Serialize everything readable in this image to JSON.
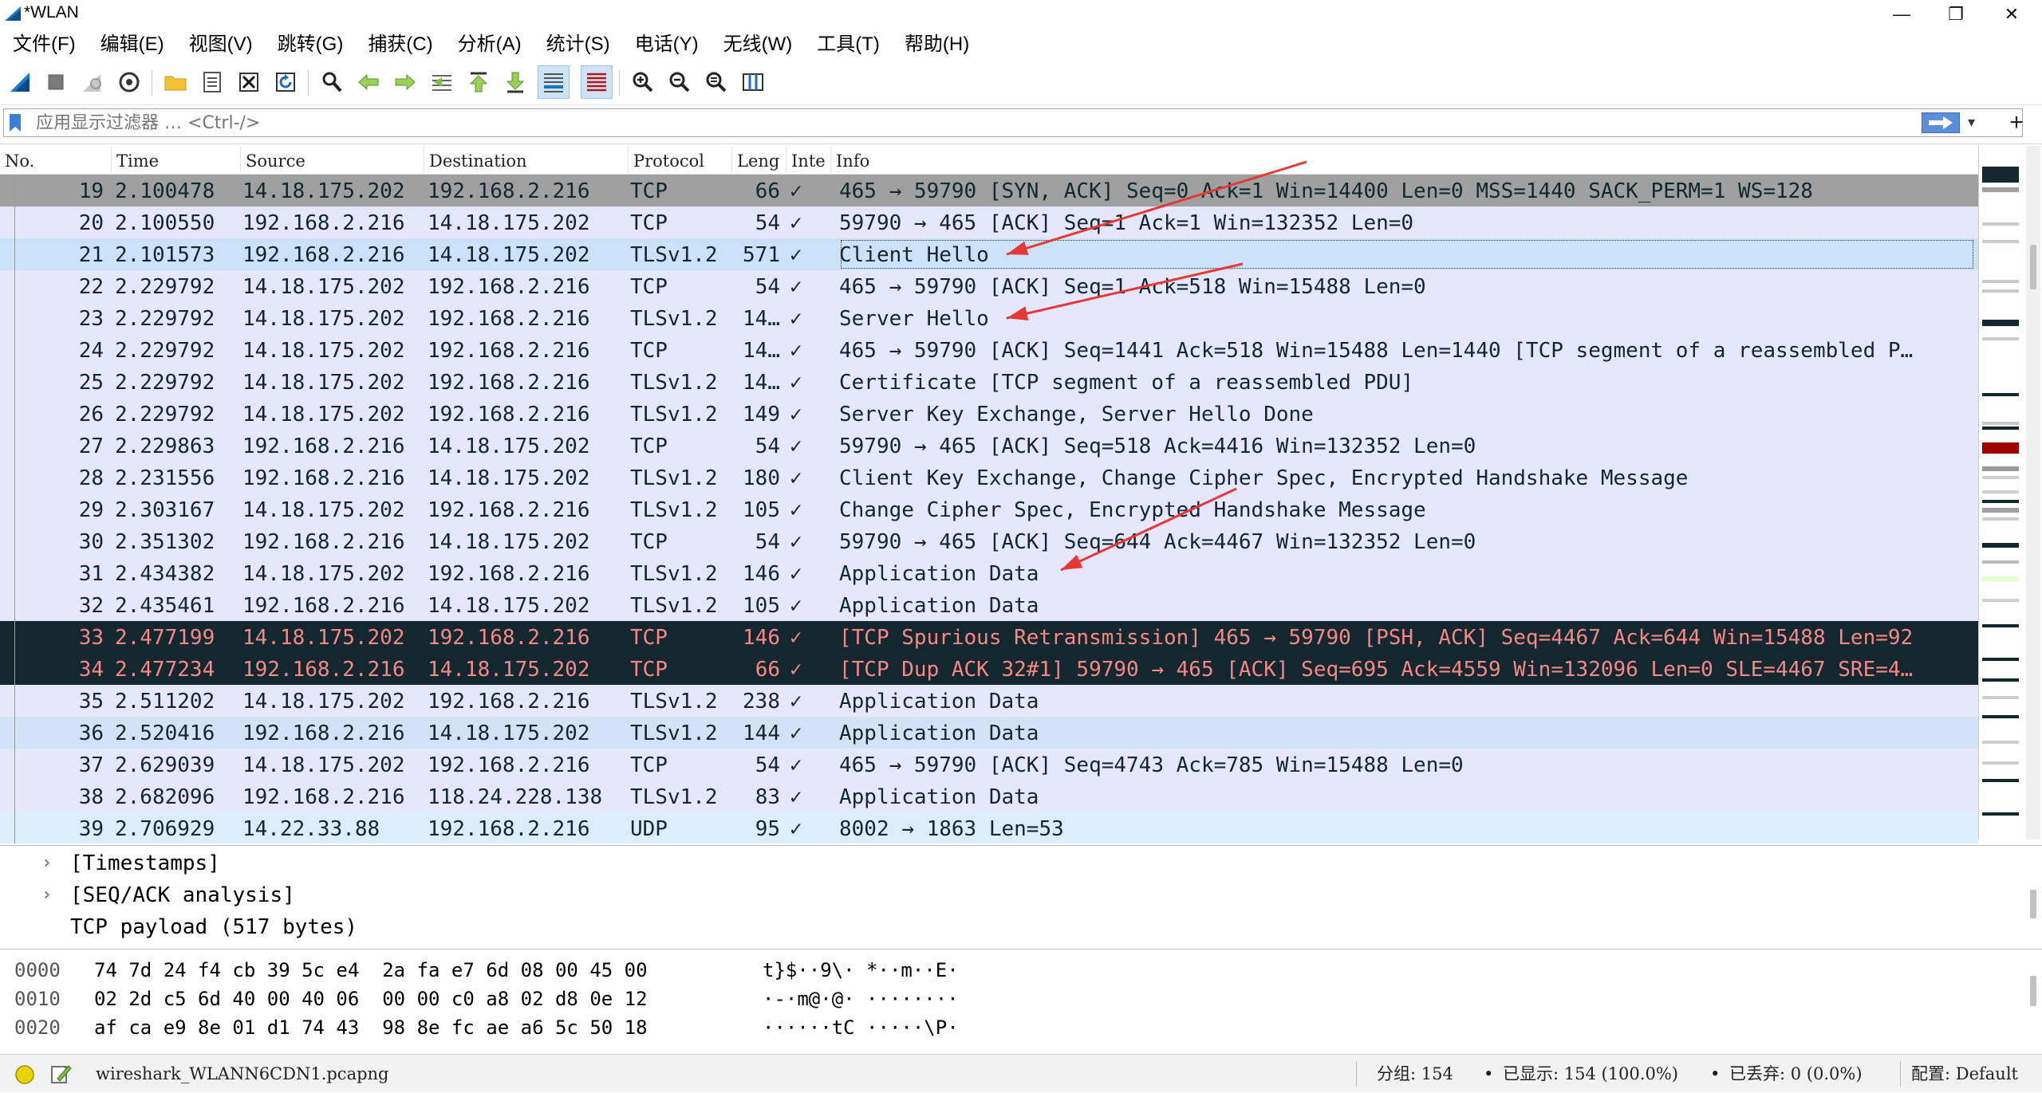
{
  "window": {
    "title": "*WLAN",
    "min_glyph": "—",
    "max_glyph": "❐",
    "close_glyph": "✕"
  },
  "menu": [
    "文件(F)",
    "编辑(E)",
    "视图(V)",
    "跳转(G)",
    "捕获(C)",
    "分析(A)",
    "统计(S)",
    "电话(Y)",
    "无线(W)",
    "工具(T)",
    "帮助(H)"
  ],
  "toolbar": {
    "icons": [
      "shark-fin-start-icon",
      "stop-capture-icon",
      "restart-capture-icon",
      "capture-options-icon",
      "open-folder-icon",
      "save-file-icon",
      "close-file-icon",
      "reload-icon",
      "find-icon",
      "go-back-icon",
      "go-forward-icon",
      "go-to-packet-icon",
      "go-first-icon",
      "go-last-icon",
      "autoscroll-icon",
      "colorize-icon",
      "zoom-in-icon",
      "zoom-out-icon",
      "zoom-normal-icon",
      "resize-columns-icon"
    ],
    "pressed": [
      "autoscroll-icon",
      "colorize-icon"
    ]
  },
  "filter": {
    "placeholder": "应用显示过滤器 … <Ctrl-/>",
    "value": "",
    "add_glyph": "+",
    "dropdown_glyph": "▾"
  },
  "columns": [
    "No.",
    "Time",
    "Source",
    "Destination",
    "Protocol",
    "Leng",
    "Inte",
    "Info"
  ],
  "packets": [
    {
      "no": "19",
      "time": "2.100478",
      "src": "14.18.175.202",
      "dst": "192.168.2.216",
      "proto": "TCP",
      "len": "66",
      "inte": "✓",
      "info": "465 → 59790 [SYN, ACK] Seq=0 Ack=1 Win=14400 Len=0 MSS=1440 SACK_PERM=1 WS=128",
      "bg": "#a0a0a0",
      "fg": "#12272e"
    },
    {
      "no": "20",
      "time": "2.100550",
      "src": "192.168.2.216",
      "dst": "14.18.175.202",
      "proto": "TCP",
      "len": "54",
      "inte": "✓",
      "info": "59790 → 465 [ACK] Seq=1 Ack=1 Win=132352 Len=0",
      "bg": "#e7e6ff",
      "fg": "#12272e"
    },
    {
      "no": "21",
      "time": "2.101573",
      "src": "192.168.2.216",
      "dst": "14.18.175.202",
      "proto": "TLSv1.2",
      "len": "571",
      "inte": "✓",
      "info": "Client Hello",
      "bg": "#cce2fa",
      "fg": "#12272e",
      "selected": true
    },
    {
      "no": "22",
      "time": "2.229792",
      "src": "14.18.175.202",
      "dst": "192.168.2.216",
      "proto": "TCP",
      "len": "54",
      "inte": "✓",
      "info": "465 → 59790 [ACK] Seq=1 Ack=518 Win=15488 Len=0",
      "bg": "#e7e6ff",
      "fg": "#12272e"
    },
    {
      "no": "23",
      "time": "2.229792",
      "src": "14.18.175.202",
      "dst": "192.168.2.216",
      "proto": "TLSv1.2",
      "len": "14…",
      "inte": "✓",
      "info": "Server Hello",
      "bg": "#e7e6ff",
      "fg": "#12272e"
    },
    {
      "no": "24",
      "time": "2.229792",
      "src": "14.18.175.202",
      "dst": "192.168.2.216",
      "proto": "TCP",
      "len": "14…",
      "inte": "✓",
      "info": "465 → 59790 [ACK] Seq=1441 Ack=518 Win=15488 Len=1440 [TCP segment of a reassembled P…",
      "bg": "#e7e6ff",
      "fg": "#12272e"
    },
    {
      "no": "25",
      "time": "2.229792",
      "src": "14.18.175.202",
      "dst": "192.168.2.216",
      "proto": "TLSv1.2",
      "len": "14…",
      "inte": "✓",
      "info": "Certificate [TCP segment of a reassembled PDU]",
      "bg": "#e7e6ff",
      "fg": "#12272e"
    },
    {
      "no": "26",
      "time": "2.229792",
      "src": "14.18.175.202",
      "dst": "192.168.2.216",
      "proto": "TLSv1.2",
      "len": "149",
      "inte": "✓",
      "info": "Server Key Exchange, Server Hello Done",
      "bg": "#e7e6ff",
      "fg": "#12272e"
    },
    {
      "no": "27",
      "time": "2.229863",
      "src": "192.168.2.216",
      "dst": "14.18.175.202",
      "proto": "TCP",
      "len": "54",
      "inte": "✓",
      "info": "59790 → 465 [ACK] Seq=518 Ack=4416 Win=132352 Len=0",
      "bg": "#e7e6ff",
      "fg": "#12272e"
    },
    {
      "no": "28",
      "time": "2.231556",
      "src": "192.168.2.216",
      "dst": "14.18.175.202",
      "proto": "TLSv1.2",
      "len": "180",
      "inte": "✓",
      "info": "Client Key Exchange, Change Cipher Spec, Encrypted Handshake Message",
      "bg": "#e7e6ff",
      "fg": "#12272e"
    },
    {
      "no": "29",
      "time": "2.303167",
      "src": "14.18.175.202",
      "dst": "192.168.2.216",
      "proto": "TLSv1.2",
      "len": "105",
      "inte": "✓",
      "info": "Change Cipher Spec, Encrypted Handshake Message",
      "bg": "#e7e6ff",
      "fg": "#12272e"
    },
    {
      "no": "30",
      "time": "2.351302",
      "src": "192.168.2.216",
      "dst": "14.18.175.202",
      "proto": "TCP",
      "len": "54",
      "inte": "✓",
      "info": "59790 → 465 [ACK] Seq=644 Ack=4467 Win=132352 Len=0",
      "bg": "#e7e6ff",
      "fg": "#12272e"
    },
    {
      "no": "31",
      "time": "2.434382",
      "src": "14.18.175.202",
      "dst": "192.168.2.216",
      "proto": "TLSv1.2",
      "len": "146",
      "inte": "✓",
      "info": "Application Data",
      "bg": "#e7e6ff",
      "fg": "#12272e"
    },
    {
      "no": "32",
      "time": "2.435461",
      "src": "192.168.2.216",
      "dst": "14.18.175.202",
      "proto": "TLSv1.2",
      "len": "105",
      "inte": "✓",
      "info": "Application Data",
      "bg": "#e7e6ff",
      "fg": "#12272e"
    },
    {
      "no": "33",
      "time": "2.477199",
      "src": "14.18.175.202",
      "dst": "192.168.2.216",
      "proto": "TCP",
      "len": "146",
      "inte": "✓",
      "info": "[TCP Spurious Retransmission] 465 → 59790 [PSH, ACK] Seq=4467 Ack=644 Win=15488 Len=92",
      "bg": "#12272e",
      "fg": "#f78787"
    },
    {
      "no": "34",
      "time": "2.477234",
      "src": "192.168.2.216",
      "dst": "14.18.175.202",
      "proto": "TCP",
      "len": "66",
      "inte": "✓",
      "info": "[TCP Dup ACK 32#1] 59790 → 465 [ACK] Seq=695 Ack=4559 Win=132096 Len=0 SLE=4467 SRE=4…",
      "bg": "#12272e",
      "fg": "#f78787"
    },
    {
      "no": "35",
      "time": "2.511202",
      "src": "14.18.175.202",
      "dst": "192.168.2.216",
      "proto": "TLSv1.2",
      "len": "238",
      "inte": "✓",
      "info": "Application Data",
      "bg": "#e7e6ff",
      "fg": "#12272e"
    },
    {
      "no": "36",
      "time": "2.520416",
      "src": "192.168.2.216",
      "dst": "14.18.175.202",
      "proto": "TLSv1.2",
      "len": "144",
      "inte": "✓",
      "info": "Application Data",
      "bg": "#d3e2f7",
      "fg": "#12272e"
    },
    {
      "no": "37",
      "time": "2.629039",
      "src": "14.18.175.202",
      "dst": "192.168.2.216",
      "proto": "TCP",
      "len": "54",
      "inte": "✓",
      "info": "465 → 59790 [ACK] Seq=4743 Ack=785 Win=15488 Len=0",
      "bg": "#e7e6ff",
      "fg": "#12272e"
    },
    {
      "no": "38",
      "time": "2.682096",
      "src": "192.168.2.216",
      "dst": "118.24.228.138",
      "proto": "TLSv1.2",
      "len": "83",
      "inte": "✓",
      "info": "Application Data",
      "bg": "#e7e6ff",
      "fg": "#12272e"
    },
    {
      "no": "39",
      "time": "2.706929",
      "src": "14.22.33.88",
      "dst": "192.168.2.216",
      "proto": "UDP",
      "len": "95",
      "inte": "✓",
      "info": "8002 → 1863 Len=53",
      "bg": "#daeeff",
      "fg": "#12272e"
    }
  ],
  "details": [
    {
      "text": "[Timestamps]",
      "expander": "›"
    },
    {
      "text": "[SEQ/ACK analysis]",
      "expander": "›"
    },
    {
      "text": "TCP payload (517 bytes)",
      "expander": ""
    }
  ],
  "hex": [
    {
      "offset": "0000",
      "bytes": "74 7d 24 f4 cb 39 5c e4  2a fa e7 6d 08 00 45 00",
      "ascii": "t}$··9\\· *··m··E·"
    },
    {
      "offset": "0010",
      "bytes": "02 2d c5 6d 40 00 40 06  00 00 c0 a8 02 d8 0e 12",
      "ascii": "·-·m@·@· ········"
    },
    {
      "offset": "0020",
      "bytes": "af ca e9 8e 01 d1 74 43  98 8e fc ae a6 5c 50 18",
      "ascii": "······tC ·····\\P·"
    }
  ],
  "status": {
    "file": "wireshark_WLANN6CDN1.pcapng",
    "packets": "分组: 154",
    "displayed": "已显示: 154 (100.0%)",
    "dropped": "已丢弃: 0 (0.0%)",
    "profile": "配置: Default",
    "sep": "•"
  },
  "colors": {
    "annotation_arrow": "#e53935",
    "dark_row_bg": "#12272e",
    "dark_row_fg": "#f78787",
    "selected_bg": "#cce2fa"
  }
}
